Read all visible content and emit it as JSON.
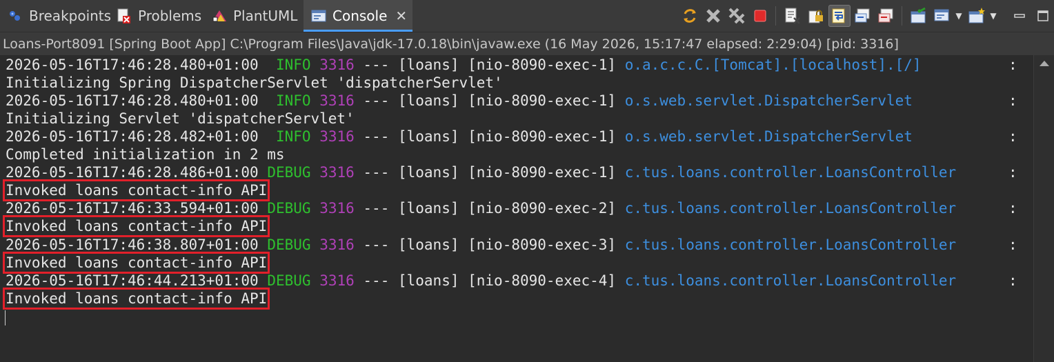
{
  "tabs": [
    {
      "label": "Breakpoints",
      "icon": "breakpoints-icon"
    },
    {
      "label": "Problems",
      "icon": "problems-icon"
    },
    {
      "label": "PlantUML",
      "icon": "plantuml-icon"
    },
    {
      "label": "Console",
      "icon": "console-icon",
      "active": true,
      "close": "✕"
    }
  ],
  "toolbar": {
    "icons": [
      "sync-icon",
      "remove-launch-icon",
      "remove-all-terminated-icon",
      "terminate-icon",
      "clear-console-icon",
      "scroll-lock-icon",
      "word-wrap-icon",
      "show-on-stdout-icon",
      "show-on-stderr-icon",
      "pin-console-icon",
      "display-selected-console-icon",
      "open-console-icon",
      "minimize-icon",
      "maximize-icon"
    ],
    "minimize": "▭",
    "maximize": "▢"
  },
  "info": "Loans-Port8091 [Spring Boot App] C:\\Program Files\\Java\\jdk-17.0.18\\bin\\javaw.exe  (16 May 2026, 15:17:47 elapsed: 2:29:04) [pid: 3316]",
  "log": [
    {
      "ts": "2026-05-16T17:46:28.480+01:00",
      "level": "INFO",
      "pid": "3316",
      "mid": " --- [loans] [nio-8090-exec-1] ",
      "logger": "o.a.c.c.C.[Tomcat].[localhost].[/]",
      "msg": "Initializing Spring DispatcherServlet 'dispatcherServlet'"
    },
    {
      "ts": "2026-05-16T17:46:28.480+01:00",
      "level": "INFO",
      "pid": "3316",
      "mid": " --- [loans] [nio-8090-exec-1] ",
      "logger": "o.s.web.servlet.DispatcherServlet",
      "msg": "Initializing Servlet 'dispatcherServlet'"
    },
    {
      "ts": "2026-05-16T17:46:28.482+01:00",
      "level": "INFO",
      "pid": "3316",
      "mid": " --- [loans] [nio-8090-exec-1] ",
      "logger": "o.s.web.servlet.DispatcherServlet",
      "msg": "Completed initialization in 2 ms"
    },
    {
      "ts": "2026-05-16T17:46:28.486+01:00",
      "level": "DEBUG",
      "pid": "3316",
      "mid": " --- [loans] [nio-8090-exec-1] ",
      "logger": "c.tus.loans.controller.LoansController",
      "msg": "Invoked loans contact-info API"
    },
    {
      "ts": "2026-05-16T17:46:33.594+01:00",
      "level": "DEBUG",
      "pid": "3316",
      "mid": " --- [loans] [nio-8090-exec-2] ",
      "logger": "c.tus.loans.controller.LoansController",
      "msg": "Invoked loans contact-info API"
    },
    {
      "ts": "2026-05-16T17:46:38.807+01:00",
      "level": "DEBUG",
      "pid": "3316",
      "mid": " --- [loans] [nio-8090-exec-3] ",
      "logger": "c.tus.loans.controller.LoansController",
      "msg": "Invoked loans contact-info API"
    },
    {
      "ts": "2026-05-16T17:46:44.213+01:00",
      "level": "DEBUG",
      "pid": "3316",
      "mid": " --- [loans] [nio-8090-exec-4] ",
      "logger": "c.tus.loans.controller.LoansController",
      "msg": "Invoked loans contact-info API"
    }
  ],
  "separator": ":",
  "colors": {
    "info": "#2ec02e",
    "debug": "#2ec02e",
    "pid": "#b040b8",
    "logger": "#3d8fdf",
    "highlight": "#e2202a"
  }
}
